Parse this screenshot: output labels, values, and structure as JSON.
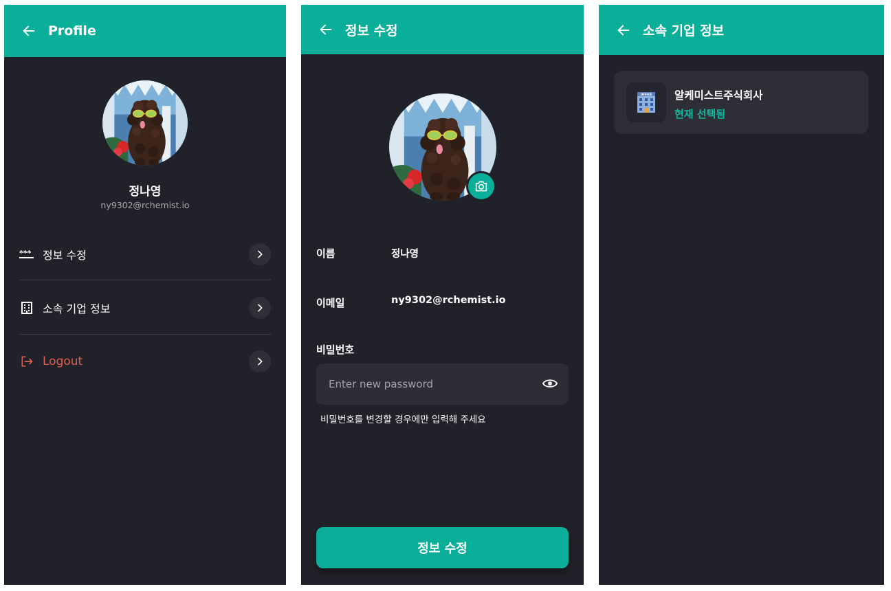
{
  "colors": {
    "accent": "#0aaf9a",
    "background": "#212229",
    "logout": "#e0614f",
    "card": "#2e2f36"
  },
  "profile_screen": {
    "title": "Profile",
    "back_icon": "arrow-left-icon",
    "user_name": "정나영",
    "user_email": "ny9302@rchemist.io",
    "menu": [
      {
        "label": "정보 수정",
        "icon": "password-dots-icon"
      },
      {
        "label": "소속 기업 정보",
        "icon": "building-icon"
      },
      {
        "label": "Logout",
        "icon": "logout-icon"
      }
    ]
  },
  "edit_screen": {
    "title": "정보 수정",
    "back_icon": "arrow-left-icon",
    "camera_icon": "camera-icon",
    "name_label": "이름",
    "name_value": "정나영",
    "email_label": "이메일",
    "email_value": "ny9302@rchemist.io",
    "password_label": "비밀번호",
    "password_placeholder": "Enter new password",
    "password_hint": "비밀번호를 변경할 경우에만 입력해 주세요",
    "submit_label": "정보 수정"
  },
  "company_screen": {
    "title": "소속 기업 정보",
    "back_icon": "arrow-left-icon",
    "company": {
      "name": "알케미스트주식회사",
      "status": "현재 선택됨",
      "logo_icon": "office-building-icon",
      "logo_text": "OFFICE"
    }
  }
}
